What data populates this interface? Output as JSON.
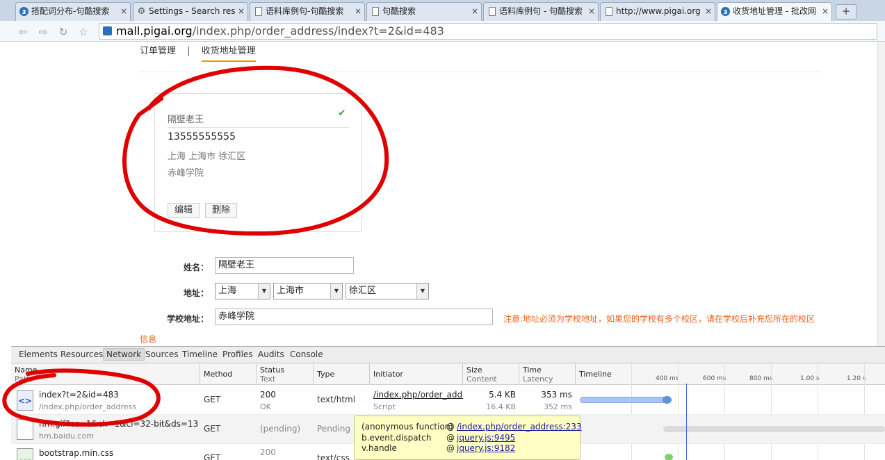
{
  "tabs": [
    {
      "title": "搭配词分布-句酷搜索",
      "icon": "globe-icon"
    },
    {
      "title": "Settings - Search res",
      "icon": "gear-icon"
    },
    {
      "title": "语料库例句-句酷搜索",
      "icon": "page-icon"
    },
    {
      "title": "句酷搜索",
      "icon": "page-icon"
    },
    {
      "title": "语料库例句 - 句酷搜索",
      "icon": "page-icon"
    },
    {
      "title": "http://www.pigai.org",
      "icon": "page-icon"
    },
    {
      "title": "收货地址管理 - 批改网",
      "icon": "globe-icon"
    }
  ],
  "newtab_label": "+",
  "address_bar": {
    "domain": "mall.pigai.org",
    "path": "/index.php/order_address/index?t=2&id=483"
  },
  "subnav": {
    "orders": "订单管理",
    "separator": "|",
    "addresses": "收货地址管理"
  },
  "address_card": {
    "name": "隔壁老王",
    "phone": "13555555555",
    "region": "上海 上海市 徐汇区",
    "school": "赤峰学院",
    "edit_label": "编辑",
    "delete_label": "删除"
  },
  "form": {
    "name_label": "姓名：",
    "name_value": "隔壁老王",
    "address_label": "地址：",
    "province": "上海",
    "city": "上海市",
    "district": "徐汇区",
    "school_label": "学校地址：",
    "school_value": "赤峰学院",
    "notice": "注意:地址必须为学校地址，如果您的学校有多个校区，请在学校后补充您所在的校区",
    "partial_text": "信息"
  },
  "devtools": {
    "tabs": [
      "Elements",
      "Resources",
      "Network",
      "Sources",
      "Timeline",
      "Profiles",
      "Audits",
      "Console"
    ],
    "active_tab": "Network",
    "columns": {
      "name": {
        "primary": "Name",
        "secondary": "Path"
      },
      "method": "Method",
      "status": {
        "primary": "Status",
        "secondary": "Text"
      },
      "type": "Type",
      "initiator": "Initiator",
      "size": {
        "primary": "Size",
        "secondary": "Content"
      },
      "time": {
        "primary": "Time",
        "secondary": "Latency"
      },
      "timeline": "Timeline"
    },
    "ticks": [
      "400 ms",
      "600 ms",
      "800 ms",
      "1.00 s",
      "1.20 s"
    ],
    "rows": [
      {
        "name": "index?t=2&id=483",
        "path": "/index.php/order_address",
        "method": "GET",
        "status": "200",
        "status_text": "OK",
        "type": "text/html",
        "initiator": "/index.php/order_add...",
        "initiator_sub": "Script",
        "size": "5.4 KB",
        "content": "16.4 KB",
        "time": "353 ms",
        "latency": "352 ms",
        "icon": "html-file-icon"
      },
      {
        "name": "hm.gif?cc=1&ck=1&cl=32-bit&ds=1366x7...",
        "path": "hm.baidu.com",
        "method": "GET",
        "status": "(pending)",
        "type": "Pending",
        "icon": "image-file-icon"
      },
      {
        "name": "bootstrap.min.css",
        "method": "GET",
        "status": "200",
        "type": "text/css",
        "icon": "css-file-icon"
      }
    ],
    "tooltip": [
      {
        "fn": "(anonymous function)",
        "at": "@",
        "link": "/index.php/order_address:233"
      },
      {
        "fn": "b.event.dispatch",
        "at": "@",
        "link": "jquery.js:9495"
      },
      {
        "fn": "v.handle",
        "at": "@",
        "link": "jquery.js:9182"
      }
    ]
  },
  "colors": {
    "accent": "#f39800",
    "notice": "#e8621e",
    "annotation": "#e00000",
    "timeline_bar": "#8fb2e8"
  }
}
